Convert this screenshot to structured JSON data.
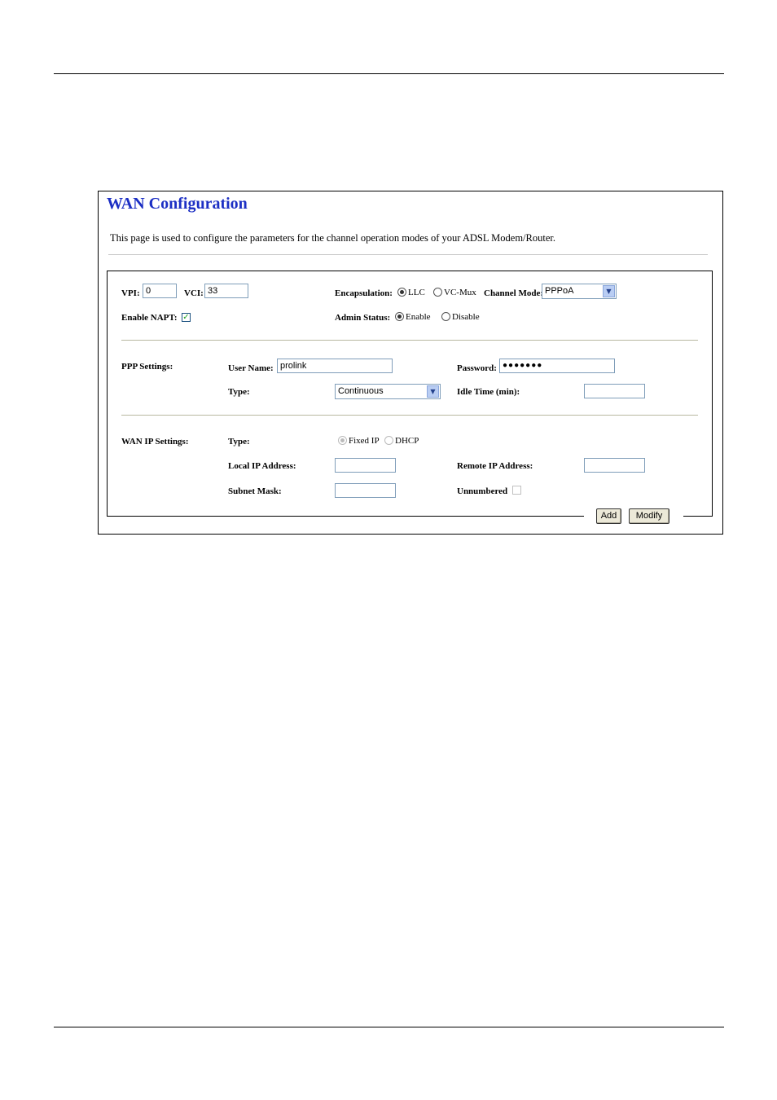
{
  "header": {
    "title": "WAN Configuration",
    "description": "This page is used to configure the parameters for the channel operation modes of your ADSL Modem/Router."
  },
  "channel": {
    "vpi_label": "VPI:",
    "vpi_value": "0",
    "vci_label": "VCI:",
    "vci_value": "33",
    "encapsulation_label": "Encapsulation:",
    "encap_llc": "LLC",
    "encap_vcmux": "VC-Mux",
    "channel_mode_label": "Channel Mode:",
    "channel_mode_value": "PPPoA",
    "napt_label": "Enable NAPT:",
    "napt_checked": "✓",
    "admin_status_label": "Admin Status:",
    "admin_enable": "Enable",
    "admin_disable": "Disable"
  },
  "ppp": {
    "section_label": "PPP Settings:",
    "username_label": "User Name:",
    "username_value": "prolink",
    "password_label": "Password:",
    "password_value": "●●●●●●●",
    "type_label": "Type:",
    "type_value": "Continuous",
    "idle_label": "Idle Time (min):",
    "idle_value": ""
  },
  "wan_ip": {
    "section_label": "WAN IP Settings:",
    "type_label": "Type:",
    "type_fixed": "Fixed IP",
    "type_dhcp": "DHCP",
    "local_ip_label": "Local IP Address:",
    "local_ip_value": "",
    "remote_ip_label": "Remote IP Address:",
    "remote_ip_value": "",
    "subnet_label": "Subnet Mask:",
    "subnet_value": "",
    "unnumbered_label": "Unnumbered"
  },
  "actions": {
    "add_label": "Add",
    "modify_label": "Modify"
  }
}
